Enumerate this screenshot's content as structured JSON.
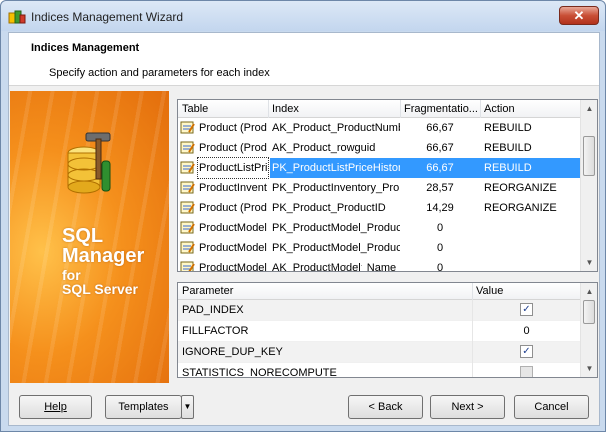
{
  "window": {
    "title": "Indices Management Wizard",
    "close_label": "✕"
  },
  "header": {
    "title": "Indices Management",
    "subtitle": "Specify action and parameters for each index"
  },
  "banner": {
    "line1": "SQL",
    "line2": "Manager",
    "line3": "for",
    "line4": "SQL Server"
  },
  "index_grid": {
    "columns": [
      "Table",
      "Index",
      "Fragmentatio...",
      "Action"
    ],
    "rows": [
      {
        "table": "Product (Prod",
        "index": "AK_Product_ProductNumb",
        "frag": "66,67",
        "action": "REBUILD"
      },
      {
        "table": "Product (Prod",
        "index": "AK_Product_rowguid",
        "frag": "66,67",
        "action": "REBUILD"
      },
      {
        "table": "ProductListPri",
        "index": "PK_ProductListPriceHistor",
        "frag": "66,67",
        "action": "REBUILD",
        "selected": true
      },
      {
        "table": "ProductInvent",
        "index": "PK_ProductInventory_Pro",
        "frag": "28,57",
        "action": "REORGANIZE"
      },
      {
        "table": "Product (Prod",
        "index": "PK_Product_ProductID",
        "frag": "14,29",
        "action": "REORGANIZE"
      },
      {
        "table": "ProductModel",
        "index": "PK_ProductModel_Produc",
        "frag": "0",
        "action": ""
      },
      {
        "table": "ProductModel",
        "index": "PK_ProductModel_Produc",
        "frag": "0",
        "action": ""
      },
      {
        "table": "ProductModel",
        "index": "AK_ProductModel_Name",
        "frag": "0",
        "action": ""
      }
    ]
  },
  "param_grid": {
    "columns": [
      "Parameter",
      "Value"
    ],
    "rows": [
      {
        "name": "PAD_INDEX",
        "type": "checkbox",
        "checked": true
      },
      {
        "name": "FILLFACTOR",
        "type": "text",
        "value": "0"
      },
      {
        "name": "IGNORE_DUP_KEY",
        "type": "checkbox",
        "checked": true
      },
      {
        "name": "STATISTICS_NORECOMPUTE",
        "type": "checkbox",
        "checked": false
      }
    ]
  },
  "buttons": {
    "help": "Help",
    "templates": "Templates",
    "back": "< Back",
    "next": "Next >",
    "cancel": "Cancel"
  },
  "colors": {
    "selection": "#3399ff",
    "banner": "#f5901c"
  }
}
